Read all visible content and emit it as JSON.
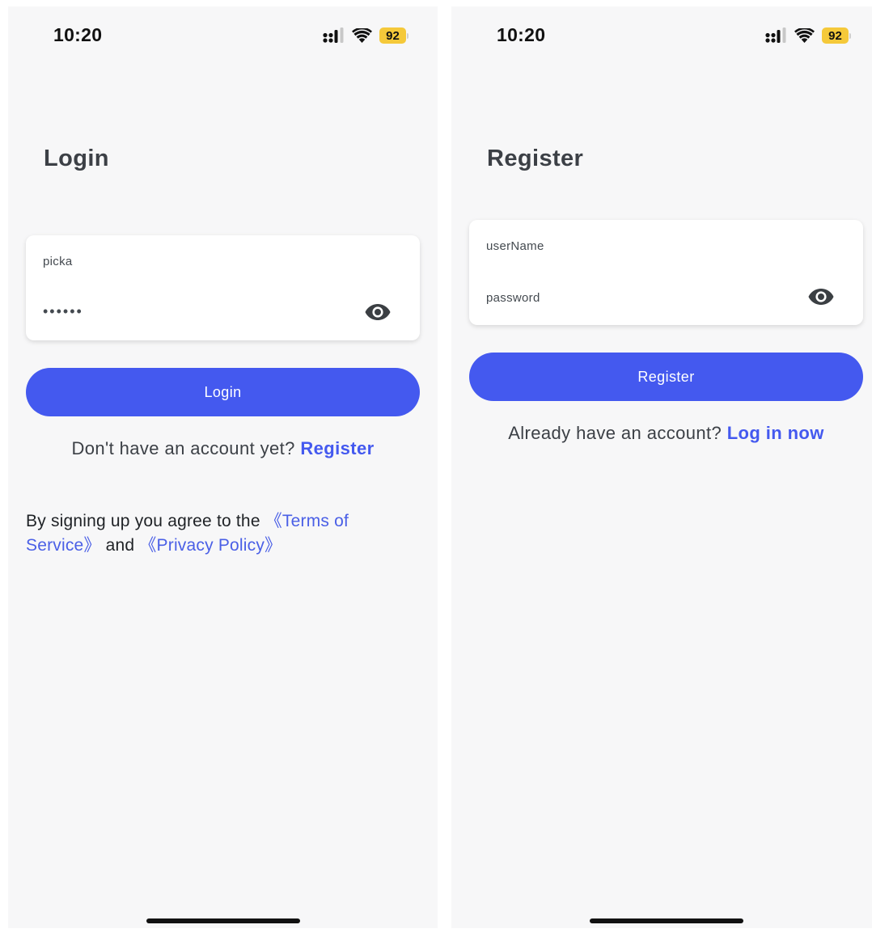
{
  "login_screen": {
    "status_bar": {
      "time": "10:20",
      "battery": "92"
    },
    "title": "Login",
    "username_value": "picka",
    "password_masked": "••••••",
    "button_label": "Login",
    "switch_prompt": "Don't have an account yet?",
    "switch_link": "Register",
    "agreement": {
      "prefix": "By signing up you agree to the ",
      "terms_link": "《Terms of Service》",
      "conjunction": " and ",
      "privacy_link": "《Privacy Policy》"
    }
  },
  "register_screen": {
    "status_bar": {
      "time": "10:20",
      "battery": "92"
    },
    "title": "Register",
    "username_placeholder": "userName",
    "password_placeholder": "password",
    "button_label": "Register",
    "switch_prompt": "Already have an account?",
    "switch_link": "Log in now"
  },
  "icons": {
    "signal": "cellular-signal-icon",
    "wifi": "wifi-icon",
    "battery": "battery-icon",
    "password_visibility": "eye-icon"
  },
  "colors": {
    "accent": "#4459ef",
    "background": "#f7f7f8",
    "battery": "#f5c93a",
    "title_text": "#3c4046"
  }
}
